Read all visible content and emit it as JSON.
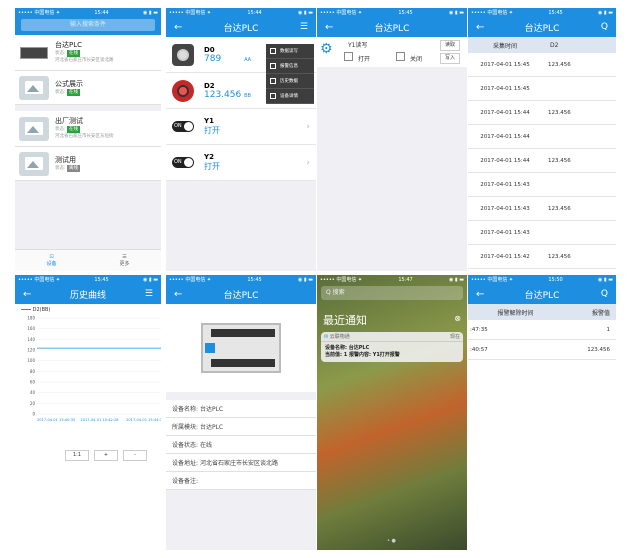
{
  "status": {
    "carrier": "••••• 中国电信 ✦",
    "time1": "15:44",
    "time2": "15:44",
    "time3": "15:45",
    "time4": "15:45",
    "time5": "15:45",
    "time6": "15:45",
    "time7": "15:47",
    "time8": "15:50",
    "battery": "◉ ▮ ▬"
  },
  "s1": {
    "search_placeholder": "输入搜索条件",
    "devices": [
      {
        "name": "台达PLC",
        "status_label": "状态:",
        "status": "在线",
        "address": "河北省石家庄市长安区谈北路"
      },
      {
        "name": "公式展示",
        "status_label": "状态:",
        "status": "在线",
        "address": ""
      },
      {
        "name": "出厂测试",
        "status_label": "状态:",
        "status": "在线",
        "address": "河北省石家庄市长安区东垣街"
      },
      {
        "name": "测试用",
        "status_label": "状态:",
        "status": "离线",
        "address": ""
      }
    ],
    "tab_device": "设备",
    "tab_more": "更多"
  },
  "s2": {
    "title": "台达PLC",
    "back": "←",
    "menu": "☰",
    "d0": {
      "label": "D0",
      "value": "789",
      "unit": "AA"
    },
    "d2": {
      "label": "D2",
      "value": "123.456",
      "unit": "BB"
    },
    "y1": {
      "label": "Y1",
      "value": "打开"
    },
    "y2": {
      "label": "Y2",
      "value": "打开"
    },
    "dropdown": [
      "数据读写",
      "报警信息",
      "历史数据",
      "设备详情"
    ]
  },
  "s3": {
    "title": "台达PLC",
    "back": "←",
    "item": "Y1读写",
    "read": "读取",
    "write": "写入",
    "open": "打开",
    "close": "关闭"
  },
  "s4": {
    "title": "台达PLC",
    "back": "←",
    "search": "Q",
    "col1": "采集时间",
    "col2": "D2",
    "rows": [
      [
        "2017-04-01 15:45",
        "123.456"
      ],
      [
        "2017-04-01 15:45",
        ""
      ],
      [
        "2017-04-01 15:44",
        "123.456"
      ],
      [
        "2017-04-01 15:44",
        ""
      ],
      [
        "2017-04-01 15:44",
        "123.456"
      ],
      [
        "2017-04-01 15:43",
        ""
      ],
      [
        "2017-04-01 15:43",
        "123.456"
      ],
      [
        "2017-04-01 15:43",
        ""
      ],
      [
        "2017-04-01 15:42",
        "123.456"
      ],
      [
        "2017-04-01 15:42",
        ""
      ]
    ]
  },
  "s5": {
    "title": "历史曲线",
    "back": "←",
    "menu": "☰",
    "btn1": "1:1",
    "btn2": "+",
    "btn3": "-"
  },
  "chart_data": {
    "type": "line",
    "series": [
      {
        "name": "D2(BB)",
        "values": [
          123.456,
          123.456,
          123.456
        ]
      }
    ],
    "x": [
      "2017-04-01 15:40:35",
      "2017-04-01 15:42:28",
      "2017-04-01 15:44:3"
    ],
    "yticks": [
      "0",
      "20",
      "40",
      "60",
      "80",
      "100",
      "120",
      "140",
      "160",
      "180"
    ],
    "ylim": [
      0,
      180
    ],
    "title": "",
    "xlabel": "",
    "ylabel": ""
  },
  "s6": {
    "title": "台达PLC",
    "back": "←",
    "fields": [
      [
        "设备名称:",
        "台达PLC"
      ],
      [
        "所属模块:",
        "台达PLC"
      ],
      [
        "设备状态:",
        "在线"
      ],
      [
        "设备地址:",
        "河北省石家庄市长安区谈北路"
      ],
      [
        "设备备注:",
        ""
      ]
    ]
  },
  "s7": {
    "search": "搜索",
    "title": "最近通知",
    "app": "云联物通",
    "when": "现在",
    "line1": "设备名称: 台达PLC",
    "line2": "当前值: 1 报警内容: Y1打开报警"
  },
  "s8": {
    "title": "台达PLC",
    "back": "←",
    "search": "Q",
    "col1": "报警解除时间",
    "col2": "报警值",
    "rows": [
      [
        ":47:35",
        "1"
      ],
      [
        ":40:57",
        "123.456"
      ]
    ]
  },
  "colors": {
    "primary": "#1e8fe0",
    "online": "#2e9e3e",
    "offline": "#888888"
  }
}
